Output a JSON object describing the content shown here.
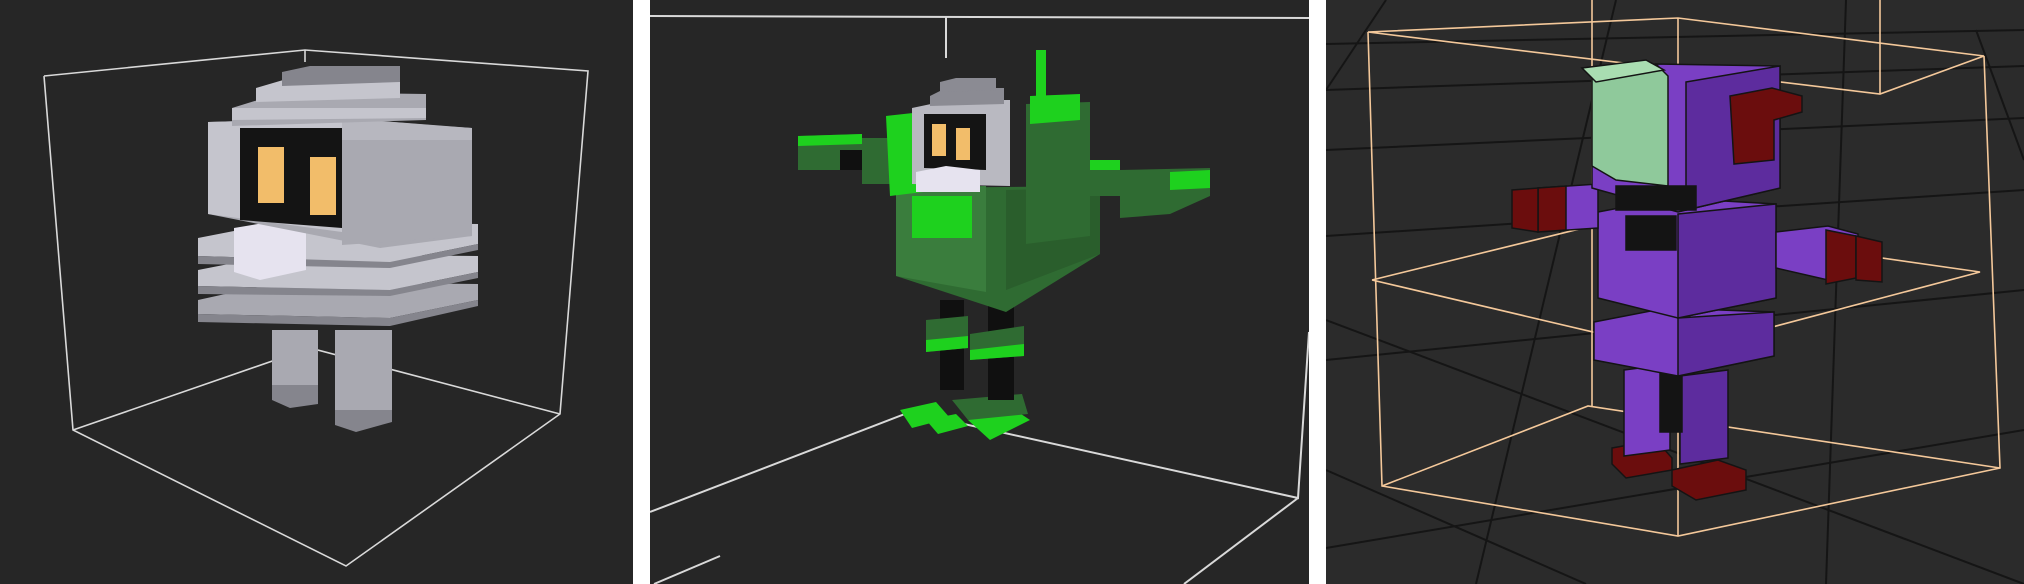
{
  "panels": [
    {
      "model": "grey-robot-voxel-model",
      "colors": {
        "background": "#262626",
        "bounding_box": "#d9d9d9",
        "body_light": "#c5c5cd",
        "body_mid": "#a9a9b1",
        "body_dark": "#85858d",
        "visor": "#141414",
        "eyes": "#f2bd6a",
        "mouth": "#e6e3ef"
      }
    },
    {
      "model": "green-robot-voxel-model",
      "colors": {
        "background": "#262626",
        "bounding_box": "#d9d9d9",
        "armor_dark": "#2f6b32",
        "armor_bright": "#1ed11e",
        "helmet": "#b9b9c1",
        "visor": "#141414",
        "eyes": "#f2bd6a",
        "joints": "#101010"
      }
    },
    {
      "model": "purple-robot-voxel-model",
      "colors": {
        "background": "#2b2b2b",
        "grid": "#151515",
        "bounding_box": "#f4c89a",
        "body": "#7a3fc4",
        "body_shade": "#5d2c9e",
        "accent": "#6b0d0d",
        "face_plate": "#8fc99b",
        "joints": "#141414"
      }
    }
  ]
}
